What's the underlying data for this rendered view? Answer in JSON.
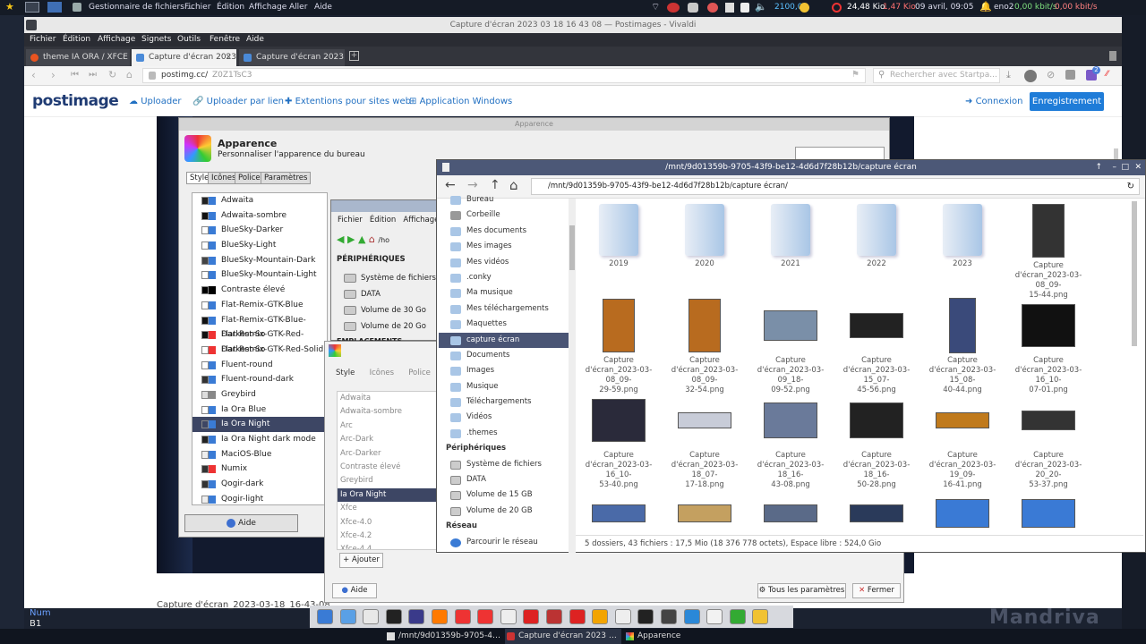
{
  "topbar": {
    "app_title": "Gestionnaire de fichiers ...",
    "menus": [
      "Fichier",
      "Édition",
      "Affichage",
      "Aller",
      "Aide"
    ],
    "cpu": "2100,0",
    "down": "24,48 Kio",
    "up": "1,47 Kio",
    "datetime": "09 avril, 09:05",
    "iface": "eno2",
    "net_down": "0,00 kbit/s",
    "net_up": "0,00 kbit/s"
  },
  "browser": {
    "window_title": "Capture d'écran 2023 03 18 16 43 08 — Postimages - Vivaldi",
    "menus": [
      "Fichier",
      "Édition",
      "Affichage",
      "Signets",
      "Outils",
      "Fenêtre",
      "Aide"
    ],
    "tabs": [
      "theme IA ORA / XFCE / For",
      "Capture d'écran 2023 03 1",
      "Capture d'écran 2023 03 1"
    ],
    "url": "postimg.cc/",
    "url_path": "Z0Z1TsC3",
    "search_placeholder": "Rechercher avec Startpa...",
    "badge": "2"
  },
  "postimage": {
    "logo": "postimage",
    "nav": [
      "Uploader",
      "Uploader par lien",
      "Extentions pour sites web",
      "Application Windows"
    ],
    "login": "Connexion",
    "register": "Enregistrement",
    "caption": "Capture d'écran_2023-03-18_16-43-08"
  },
  "appearance": {
    "window_title": "Apparence",
    "title": "Apparence",
    "subtitle": "Personnaliser l'apparence du bureau",
    "tabs": [
      "Style",
      "Icônes",
      "Polices",
      "Paramètres"
    ],
    "themes": [
      "Adwaita",
      "Adwaita-sombre",
      "BlueSky-Darker",
      "BlueSky-Light",
      "BlueSky-Mountain-Dark",
      "BlueSky-Mountain-Light",
      "Contraste élevé",
      "Flat-Remix-GTK-Blue",
      "Flat-Remix-GTK-Blue-Darkest-So",
      "Flat-Remix-GTK-Red-Darkest-So",
      "Flat-Remix-GTK-Red-Solid",
      "Fluent-round",
      "Fluent-round-dark",
      "Greybird",
      "Ia Ora Blue",
      "Ia Ora Night",
      "Ia Ora Night dark mode",
      "MaciOS-Blue",
      "Numix",
      "Qogir-dark",
      "Qogir-light"
    ],
    "selected": "Ia Ora Night",
    "help": "Aide"
  },
  "mini_fm": {
    "menus": [
      "Fichier",
      "Édition",
      "Affichage"
    ],
    "path": "/ho",
    "devices_title": "PÉRIPHÉRIQUES",
    "devices": [
      "Système de fichiers",
      "DATA",
      "Volume de 30 Go",
      "Volume de 20 Go"
    ],
    "places": "EMPLACEMENTS"
  },
  "appearance2": {
    "tabs": [
      "Style",
      "Icônes",
      "Police"
    ],
    "themes": [
      "Adwaita",
      "Adwaita-sombre",
      "Arc",
      "Arc-Dark",
      "Arc-Darker",
      "Contraste élevé",
      "Greybird",
      "Ia Ora Night",
      "Xfce",
      "Xfce-4.0",
      "Xfce-4.2",
      "Xfce-4.4"
    ],
    "selected": "Ia Ora Night",
    "add": "Ajouter",
    "help": "Aide",
    "all_settings": "Tous les paramètres",
    "close": "Fermer"
  },
  "thunar": {
    "title": "/mnt/9d01359b-9705-43f9-be12-4d6d7f28b12b/capture écran",
    "path": "/mnt/9d01359b-9705-43f9-be12-4d6d7f28b12b/capture écran/",
    "sidebar": [
      {
        "l": "Bureau"
      },
      {
        "l": "Corbeille"
      },
      {
        "l": "Mes documents"
      },
      {
        "l": "Mes images"
      },
      {
        "l": "Mes vidéos"
      },
      {
        "l": ".conky"
      },
      {
        "l": "Ma musique"
      },
      {
        "l": "Mes téléchargements"
      },
      {
        "l": "Maquettes"
      },
      {
        "l": "capture écran"
      },
      {
        "l": "Documents"
      },
      {
        "l": "Images"
      },
      {
        "l": "Musique"
      },
      {
        "l": "Téléchargements"
      },
      {
        "l": "Vidéos"
      },
      {
        "l": ".themes"
      },
      {
        "l": "Périphériques",
        "h": true
      },
      {
        "l": "Système de fichiers"
      },
      {
        "l": "DATA"
      },
      {
        "l": "Volume de 15 GB"
      },
      {
        "l": "Volume de 20 GB"
      },
      {
        "l": "Réseau",
        "h": true
      },
      {
        "l": "Parcourir le réseau"
      }
    ],
    "selected": "capture écran",
    "files": [
      [
        "2019"
      ],
      [
        "2020"
      ],
      [
        "2021"
      ],
      [
        "2022"
      ],
      [
        "2023"
      ],
      [
        "Capture",
        "d'écran_2023-03-08_09-",
        "15-44.png"
      ],
      [
        "Capture",
        "d'écran_2023-03-08_09-",
        "29-59.png"
      ],
      [
        "Capture",
        "d'écran_2023-03-08_09-",
        "32-54.png"
      ],
      [
        "Capture",
        "d'écran_2023-03-09_18-",
        "09-52.png"
      ],
      [
        "Capture",
        "d'écran_2023-03-15_07-",
        "45-56.png"
      ],
      [
        "Capture",
        "d'écran_2023-03-15_08-",
        "40-44.png"
      ],
      [
        "Capture",
        "d'écran_2023-03-16_10-",
        "07-01.png"
      ],
      [
        "Capture",
        "d'écran_2023-03-16_10-",
        "53-40.png"
      ],
      [
        "Capture",
        "d'écran_2023-03-18_07-",
        "17-18.png"
      ],
      [
        "Capture",
        "d'écran_2023-03-18_16-",
        "43-08.png"
      ],
      [
        "Capture",
        "d'écran_2023-03-18_16-",
        "50-28.png"
      ],
      [
        "Capture",
        "d'écran_2023-03-19_09-",
        "16-41.png"
      ],
      [
        "Capture",
        "d'écran_2023-03-20_20-",
        "53-37.png"
      ]
    ],
    "status": "5 dossiers, 43 fichiers : 17,5 Mio (18 376 778 octets), Espace libre : 524,0 Gio"
  },
  "statusbar": {
    "num": "Num",
    "b1": "B1"
  },
  "taskbar": [
    "/mnt/9d01359b-9705-43f9-b...",
    "Capture d'écran 2023 03 18 1...",
    "Apparence"
  ],
  "brand": "Mandriva"
}
